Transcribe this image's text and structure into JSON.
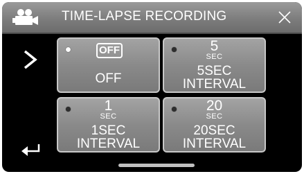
{
  "header": {
    "title": "TIME-LAPSE RECORDING",
    "mode_icon": "video-camera-icon",
    "close_icon": "close-icon"
  },
  "side": {
    "next_icon": "chevron-right-icon",
    "back_icon": "return-arrow-icon"
  },
  "options": [
    {
      "badge": "OFF",
      "value": "",
      "unit": "",
      "label_line1": "OFF",
      "label_line2": "",
      "selected": true
    },
    {
      "badge": "",
      "value": "5",
      "unit": "SEC",
      "label_line1": "5SEC",
      "label_line2": "INTERVAL",
      "selected": false
    },
    {
      "badge": "",
      "value": "1",
      "unit": "SEC",
      "label_line1": "1SEC",
      "label_line2": "INTERVAL",
      "selected": false
    },
    {
      "badge": "",
      "value": "20",
      "unit": "SEC",
      "label_line1": "20SEC",
      "label_line2": "INTERVAL",
      "selected": false
    }
  ],
  "colors": {
    "background": "#000000",
    "tile": "#8a8a8a",
    "tile_border": "#c8c8c8",
    "text": "#ffffff",
    "indicator_active": "#ffffff",
    "indicator_inactive": "#2e2e2e"
  }
}
